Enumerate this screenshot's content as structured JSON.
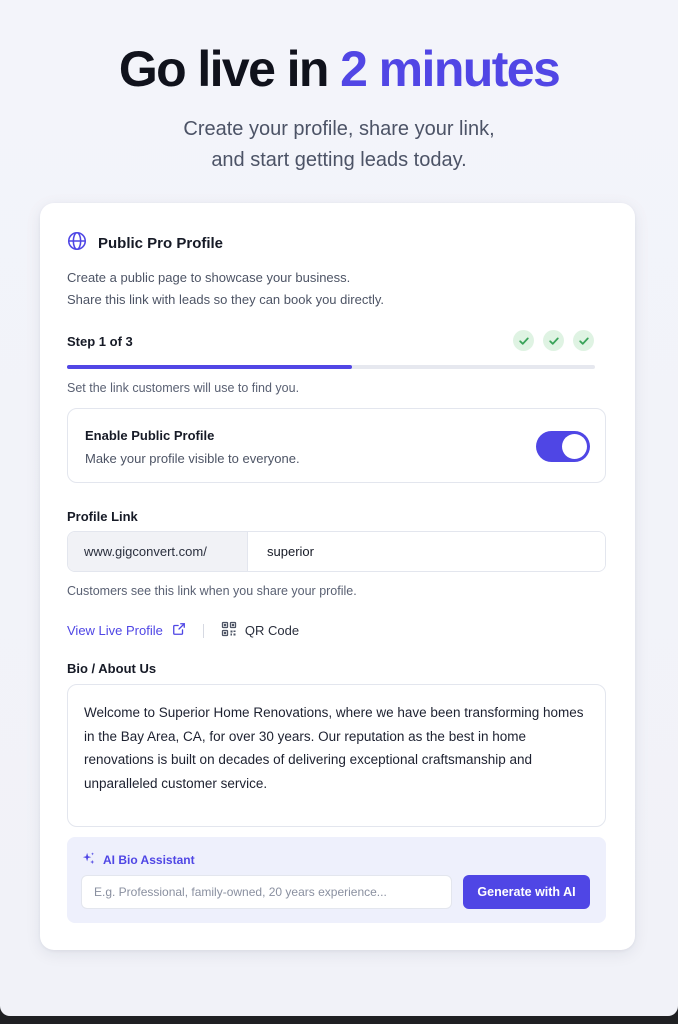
{
  "hero": {
    "title_start": "Go live in ",
    "title_accent": "2 minutes",
    "subtitle_line1": "Create your profile, share your link,",
    "subtitle_line2": "and start getting leads today."
  },
  "card": {
    "title": "Public Pro Profile",
    "header_icon": "globe-icon",
    "desc_line1": "Create a public page to showcase your business.",
    "desc_line2": "Share this link with leads so they can book you directly.",
    "step_label": "Step 1 of 3",
    "step_progress": 0.54,
    "completed_checks": 3,
    "step_hint": "Set the link customers will use to find you."
  },
  "toggle": {
    "title": "Enable Public Profile",
    "desc": "Make your profile visible to everyone.",
    "enabled": true
  },
  "profile_link": {
    "label": "Profile Link",
    "prefix": "www.gigconvert.com/",
    "value": "superior",
    "hint": "Customers see this link when you share your profile."
  },
  "actions": {
    "view_live": "View Live Profile",
    "qr_code": "QR Code"
  },
  "bio": {
    "label": "Bio / About Us",
    "text": "Welcome to Superior Home Renovations, where we have been transforming homes in the Bay Area, CA, for over 30 years. Our reputation as the best in home renovations is built on decades of delivering exceptional craftsmanship and unparalleled customer service."
  },
  "ai": {
    "title": "AI Bio Assistant",
    "placeholder": "E.g. Professional, family-owned, 20 years experience...",
    "button": "Generate with AI"
  },
  "colors": {
    "accent": "#4f46e5",
    "check_bg": "#dff3e3",
    "check_mark": "#3aa35a",
    "ai_panel_bg": "#eef0fc"
  }
}
